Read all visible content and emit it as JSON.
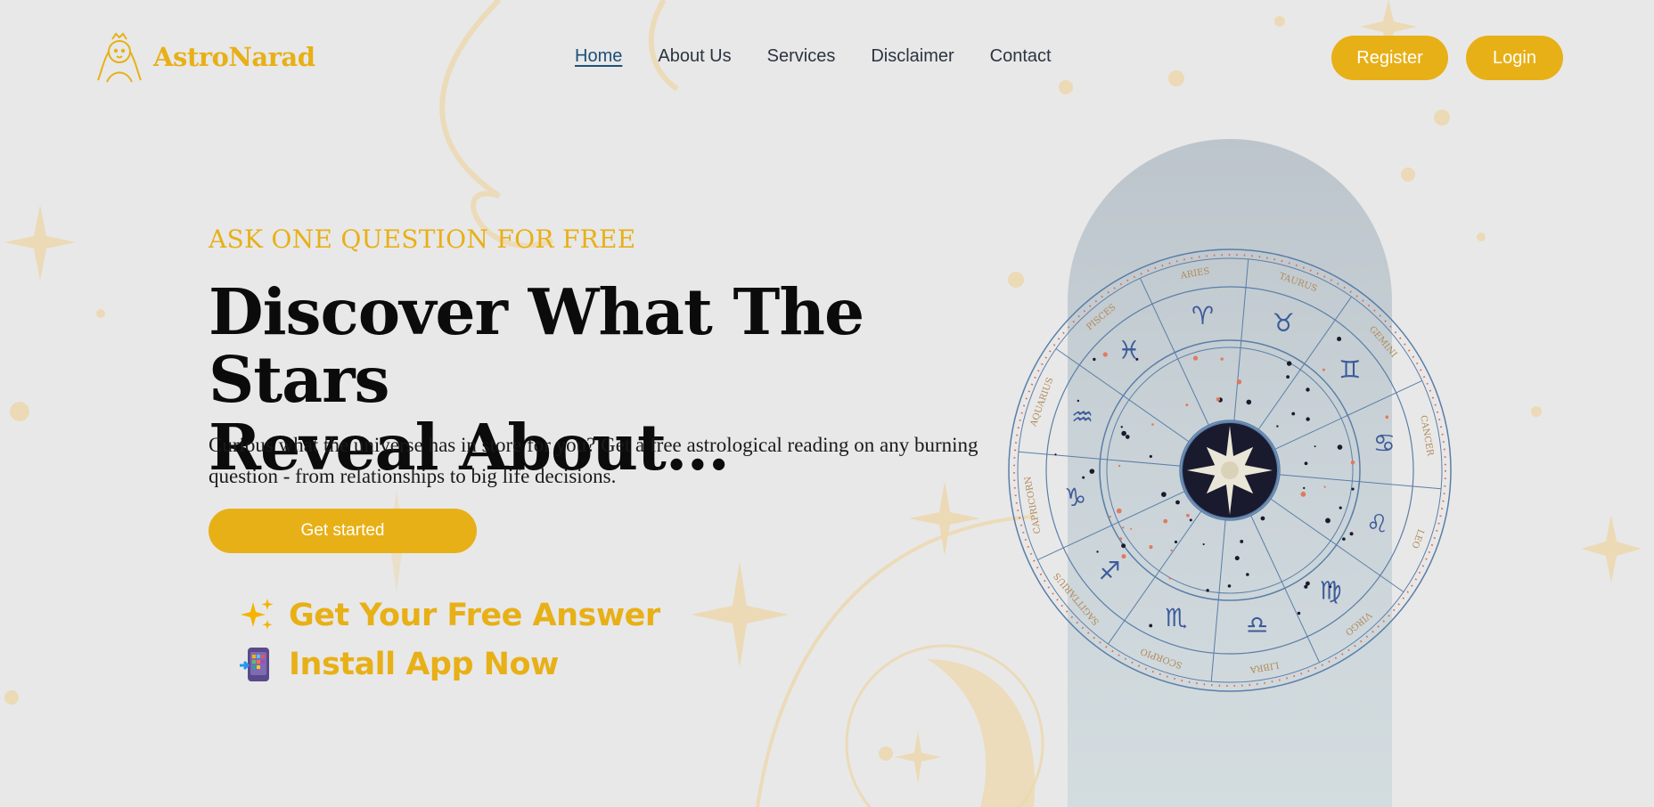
{
  "brand": {
    "name": "AstroNarad",
    "color": "#e8b017"
  },
  "nav": {
    "items": [
      {
        "label": "Home",
        "active": true
      },
      {
        "label": "About Us",
        "active": false
      },
      {
        "label": "Services",
        "active": false
      },
      {
        "label": "Disclaimer",
        "active": false
      },
      {
        "label": "Contact",
        "active": false
      }
    ]
  },
  "auth": {
    "register_label": "Register",
    "login_label": "Login"
  },
  "hero": {
    "kicker": "ASK ONE QUESTION FOR FREE",
    "headline_line1": "Discover What The Stars",
    "headline_line2": "Reveal About...",
    "lede": "Curious what the universe has in store for you? Get a free astrological reading on any burning question - from relationships to big life decisions.",
    "cta_label": "Get started",
    "links": [
      {
        "icon": "sparkles-icon",
        "label": "Get Your Free Answer"
      },
      {
        "icon": "mobile-app-icon",
        "label": "Install App Now"
      }
    ]
  },
  "zodiac_wheel": {
    "signs": [
      "ARIES",
      "TAURUS",
      "GEMINI",
      "CANCER",
      "LEO",
      "VIRGO",
      "LIBRA",
      "SCORPIO",
      "SAGITTARIUS",
      "CAPRICORN",
      "AQUARIUS",
      "PISCES"
    ],
    "glyphs": [
      "♈",
      "♉",
      "♊",
      "♋",
      "♌",
      "♍",
      "♎",
      "♏",
      "♐",
      "♑",
      "♒",
      "♓"
    ]
  },
  "colors": {
    "accent": "#e8b017",
    "background": "#e8e8e8",
    "nav_text": "#2c3440",
    "nav_active": "#1e4f78",
    "wheel_line": "#5a7ea8",
    "wheel_center": "#1a1a2e"
  }
}
